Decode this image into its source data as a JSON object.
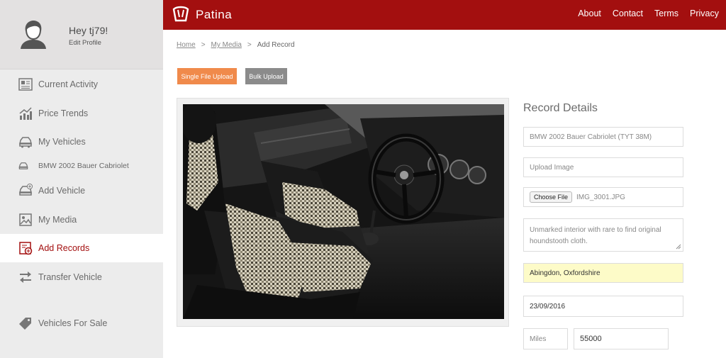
{
  "profile": {
    "greeting": "Hey tj79!",
    "edit_label": "Edit Profile"
  },
  "sidebar": {
    "items": [
      {
        "label": "Current Activity",
        "icon": "newspaper-icon"
      },
      {
        "label": "Price Trends",
        "icon": "bar-chart-icon"
      },
      {
        "label": "My Vehicles",
        "icon": "car-icon"
      },
      {
        "label": "BMW 2002 Bauer Cabriolet",
        "icon": "car-small-icon"
      },
      {
        "label": "Add Vehicle",
        "icon": "car-plus-icon"
      },
      {
        "label": "My Media",
        "icon": "image-icon"
      },
      {
        "label": "Add Records",
        "icon": "record-add-icon",
        "active": true
      },
      {
        "label": "Transfer Vehicle",
        "icon": "transfer-arrows-icon"
      },
      {
        "label": "Vehicles For Sale",
        "icon": "price-tag-icon"
      }
    ]
  },
  "header": {
    "logo_text": "Patina",
    "nav": [
      "About",
      "Contact",
      "Terms",
      "Privacy"
    ]
  },
  "breadcrumb": {
    "home": "Home",
    "media": "My Media",
    "current": "Add Record",
    "separator": ">"
  },
  "upload": {
    "single_label": "Single File Upload",
    "bulk_label": "Bulk Upload"
  },
  "form": {
    "title": "Record Details",
    "vehicle_value": "BMW 2002 Bauer Cabriolet (TYT 38M)",
    "upload_placeholder": "Upload Image",
    "choose_file_label": "Choose File",
    "file_name": "IMG_3001.JPG",
    "description_value": "Unmarked interior with rare to find original houndstooth cloth.",
    "location_value": "Abingdon, Oxfordshire",
    "date_value": "23/09/2016",
    "units_value": "Miles",
    "mileage_value": "55000"
  },
  "colors": {
    "brand": "#a30f0f",
    "accent_orange": "#f08a4b",
    "bulk_grey": "#8b8b8b",
    "highlight": "#fdfbc8"
  }
}
